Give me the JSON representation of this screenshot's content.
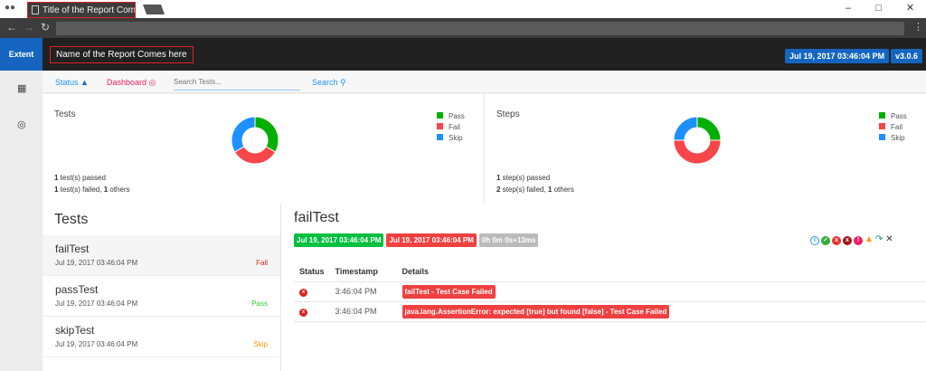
{
  "browser": {
    "tab_title": "Title of the Report Comes here"
  },
  "header": {
    "brand": "Extent",
    "report_name": "Name of the Report Comes here",
    "date": "Jul 19, 2017 03:46:04 PM",
    "version": "v3.0.6"
  },
  "nav": {
    "status": "Status",
    "dashboard": "Dashboard",
    "search_placeholder": "Search Tests...",
    "search": "Search"
  },
  "tests_card": {
    "title": "Tests",
    "legend": [
      "Pass",
      "Fail",
      "Skip"
    ],
    "summary1_n": "1",
    "summary1": " test(s) passed",
    "summary2_n": "1",
    "summary2": " test(s) failed, ",
    "summary2_o": "1",
    "summary2_t": " others"
  },
  "steps_card": {
    "title": "Steps",
    "legend": [
      "Pass",
      "Fail",
      "Skip"
    ],
    "summary1_n": "1",
    "summary1": " step(s) passed",
    "summary2_n": "2",
    "summary2": " step(s) failed, ",
    "summary2_o": "1",
    "summary2_t": " others"
  },
  "chart_data": [
    {
      "type": "pie",
      "categories": [
        "Pass",
        "Fail",
        "Skip"
      ],
      "values": [
        1,
        1,
        1
      ],
      "colors": [
        "#00af00",
        "#f7464a",
        "#1e90ff"
      ]
    },
    {
      "type": "pie",
      "categories": [
        "Pass",
        "Fail",
        "Skip"
      ],
      "values": [
        1,
        2,
        1
      ],
      "colors": [
        "#00af00",
        "#f7464a",
        "#1e90ff"
      ]
    }
  ],
  "list": {
    "title": "Tests",
    "items": [
      {
        "name": "failTest",
        "time": "Jul 19, 2017 03:46:04 PM",
        "status": "Fail",
        "color": "#e02020"
      },
      {
        "name": "passTest",
        "time": "Jul 19, 2017 03:46:04 PM",
        "status": "Pass",
        "color": "#32cd32"
      },
      {
        "name": "skipTest",
        "time": "Jul 19, 2017 03:46:04 PM",
        "status": "Skip",
        "color": "#ff9800"
      }
    ]
  },
  "detail": {
    "title": "failTest",
    "start": "Jul 19, 2017 03:46:04 PM",
    "end": "Jul 19, 2017 03:46:04 PM",
    "duration": "0h 0m 0s+13ms",
    "headers": [
      "Status",
      "Timestamp",
      "Details"
    ],
    "rows": [
      {
        "time": "3:46:04 PM",
        "details": "failTest - Test Case Failed"
      },
      {
        "time": "3:46:04 PM",
        "details": "java.lang.AssertionError: expected [true] but found [false] - Test Case Failed"
      }
    ]
  }
}
